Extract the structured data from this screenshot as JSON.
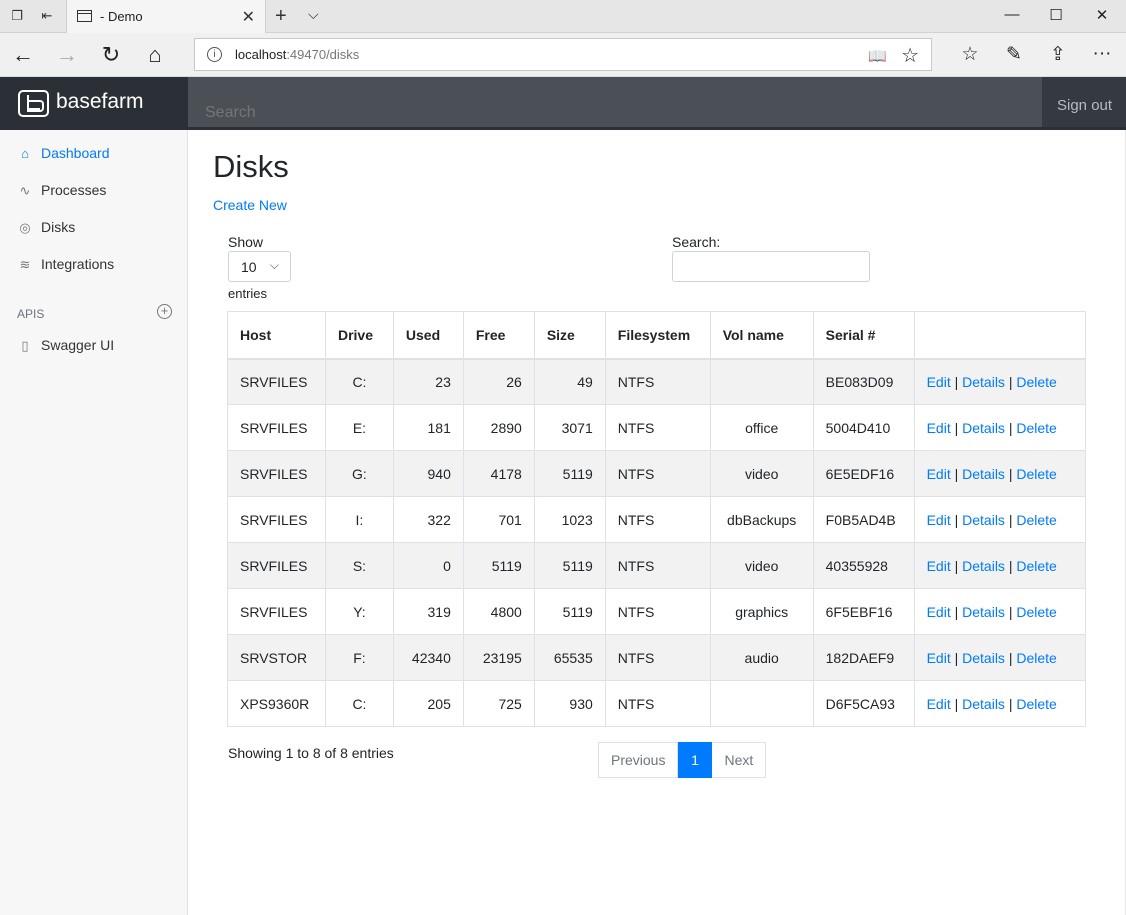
{
  "browser": {
    "tab_title": "- Demo",
    "url_host": "localhost",
    "url_rest": ":49470/disks"
  },
  "header": {
    "brand": "basefarm",
    "search_placeholder": "Search",
    "signout": "Sign out"
  },
  "sidebar": {
    "items": [
      {
        "label": "Dashboard",
        "icon": "home-icon"
      },
      {
        "label": "Processes",
        "icon": "activity-icon"
      },
      {
        "label": "Disks",
        "icon": "disc-icon"
      },
      {
        "label": "Integrations",
        "icon": "layers-icon"
      }
    ],
    "section_title": "APIS",
    "api_items": [
      {
        "label": "Swagger UI",
        "icon": "book-icon"
      }
    ]
  },
  "main": {
    "title": "Disks",
    "create_new": "Create New",
    "show_label": "Show",
    "page_length": "10",
    "entries_label": "entries",
    "search_label": "Search:",
    "columns": [
      "Host",
      "Drive",
      "Used",
      "Free",
      "Size",
      "Filesystem",
      "Vol name",
      "Serial #",
      ""
    ],
    "rows": [
      [
        "SRVFILES",
        "C:",
        "23",
        "26",
        "49",
        "NTFS",
        "",
        "BE083D09"
      ],
      [
        "SRVFILES",
        "E:",
        "181",
        "2890",
        "3071",
        "NTFS",
        "office",
        "5004D410"
      ],
      [
        "SRVFILES",
        "G:",
        "940",
        "4178",
        "5119",
        "NTFS",
        "video",
        "6E5EDF16"
      ],
      [
        "SRVFILES",
        "I:",
        "322",
        "701",
        "1023",
        "NTFS",
        "dbBackups",
        "F0B5AD4B"
      ],
      [
        "SRVFILES",
        "S:",
        "0",
        "5119",
        "5119",
        "NTFS",
        "video",
        "40355928"
      ],
      [
        "SRVFILES",
        "Y:",
        "319",
        "4800",
        "5119",
        "NTFS",
        "graphics",
        "6F5EBF16"
      ],
      [
        "SRVSTOR",
        "F:",
        "42340",
        "23195",
        "65535",
        "NTFS",
        "audio",
        "182DAEF9"
      ],
      [
        "XPS9360R",
        "C:",
        "205",
        "725",
        "930",
        "NTFS",
        "",
        "D6F5CA93"
      ]
    ],
    "row_actions": {
      "edit": "Edit",
      "details": "Details",
      "delete": "Delete",
      "sep": "|"
    },
    "info": "Showing 1 to 8 of 8 entries",
    "pager": {
      "previous": "Previous",
      "current": "1",
      "next": "Next"
    }
  },
  "colors": {
    "accent": "#007bff",
    "header_bg": "#343a40",
    "sidebar_bg": "#f7f7f7"
  }
}
